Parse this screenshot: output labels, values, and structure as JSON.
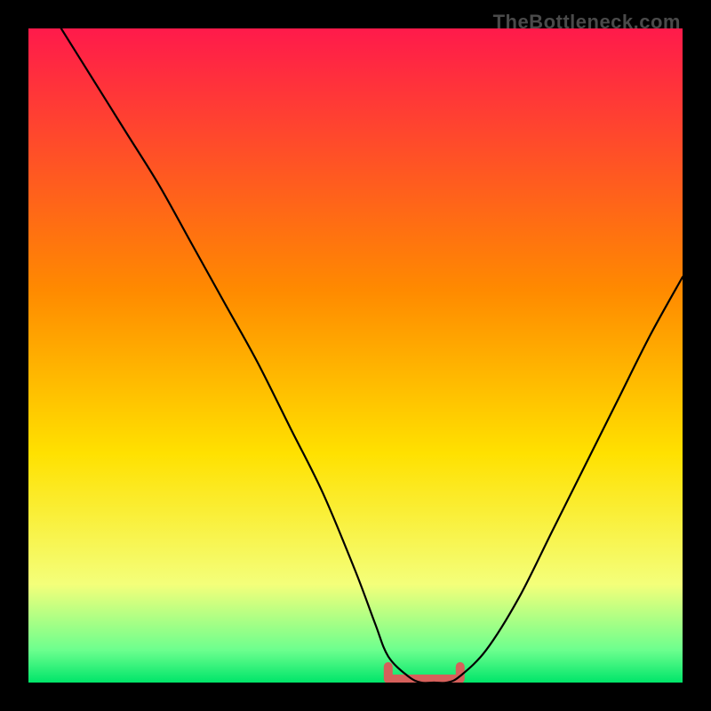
{
  "watermark": "TheBottleneck.com",
  "colors": {
    "frame": "#000000",
    "gradient_top": "#ff1a4b",
    "gradient_mid1": "#ff8a00",
    "gradient_mid2": "#ffe100",
    "gradient_low": "#f4ff7a",
    "gradient_bottom1": "#6dff8e",
    "gradient_bottom2": "#00e56a",
    "curve": "#000000",
    "valley_marker": "#d6605b"
  },
  "chart_data": {
    "type": "line",
    "title": "",
    "xlabel": "",
    "ylabel": "",
    "xlim": [
      0,
      100
    ],
    "ylim": [
      0,
      100
    ],
    "grid": false,
    "legend": false,
    "annotations": [
      {
        "text": "TheBottleneck.com",
        "position": "top-right"
      }
    ],
    "series": [
      {
        "name": "bottleneck-curve",
        "color": "#000000",
        "x": [
          5,
          10,
          15,
          20,
          25,
          30,
          35,
          40,
          45,
          50,
          53,
          55,
          58,
          60,
          62,
          64,
          66,
          70,
          75,
          80,
          85,
          90,
          95,
          100
        ],
        "y": [
          100,
          92,
          84,
          76,
          67,
          58,
          49,
          39,
          29,
          17,
          9,
          4,
          1,
          0,
          0,
          0,
          1,
          5,
          13,
          23,
          33,
          43,
          53,
          62
        ]
      }
    ],
    "valley_marker": {
      "name": "optimal-range",
      "color": "#d6605b",
      "x_range": [
        55,
        66
      ],
      "y": 0
    }
  }
}
